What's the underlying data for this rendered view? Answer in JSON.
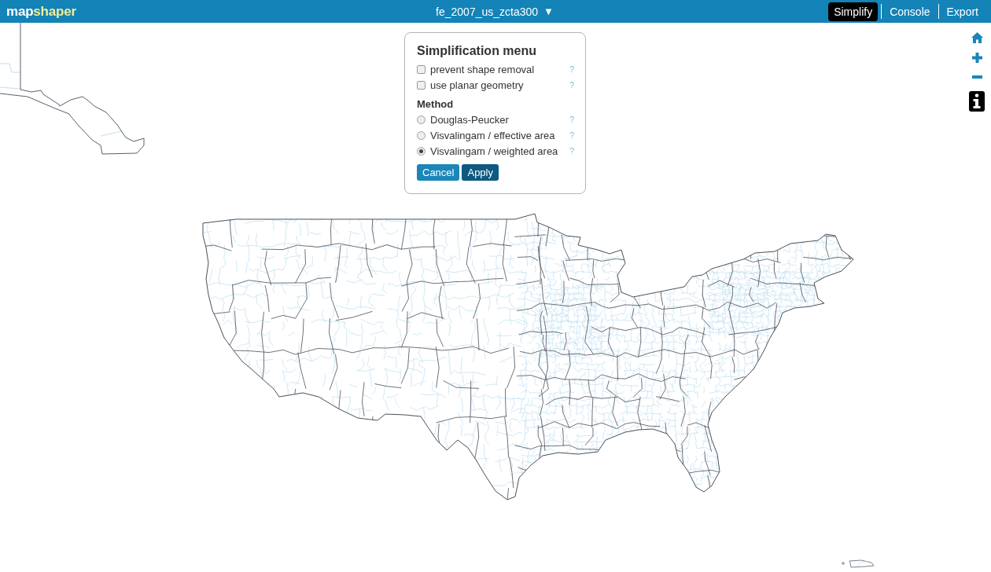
{
  "header": {
    "logo": [
      {
        "text": "map",
        "color": "#ffffff"
      },
      {
        "text": "shaper",
        "color": "#f3ee97"
      }
    ],
    "layer_menu": {
      "label": "fe_2007_us_zcta300",
      "caret": "▼"
    },
    "nav": [
      {
        "label": "Simplify",
        "selected": true
      },
      {
        "label": "Console",
        "selected": false
      },
      {
        "label": "Export",
        "selected": false
      }
    ]
  },
  "simplification_menu": {
    "title": "Simplification menu",
    "options": [
      {
        "label": "prevent shape removal",
        "checked": false,
        "help": "?"
      },
      {
        "label": "use planar geometry",
        "checked": false,
        "help": "?"
      }
    ],
    "method": {
      "heading": "Method",
      "choices": [
        {
          "label": "Douglas-Peucker",
          "selected": false,
          "help": "?"
        },
        {
          "label": "Visvalingam / effective area",
          "selected": false,
          "help": "?"
        },
        {
          "label": "Visvalingam / weighted area",
          "selected": true,
          "help": "?"
        }
      ]
    },
    "buttons": [
      {
        "label": "Cancel",
        "kind": "secondary"
      },
      {
        "label": "Apply",
        "kind": "primary"
      }
    ]
  }
}
